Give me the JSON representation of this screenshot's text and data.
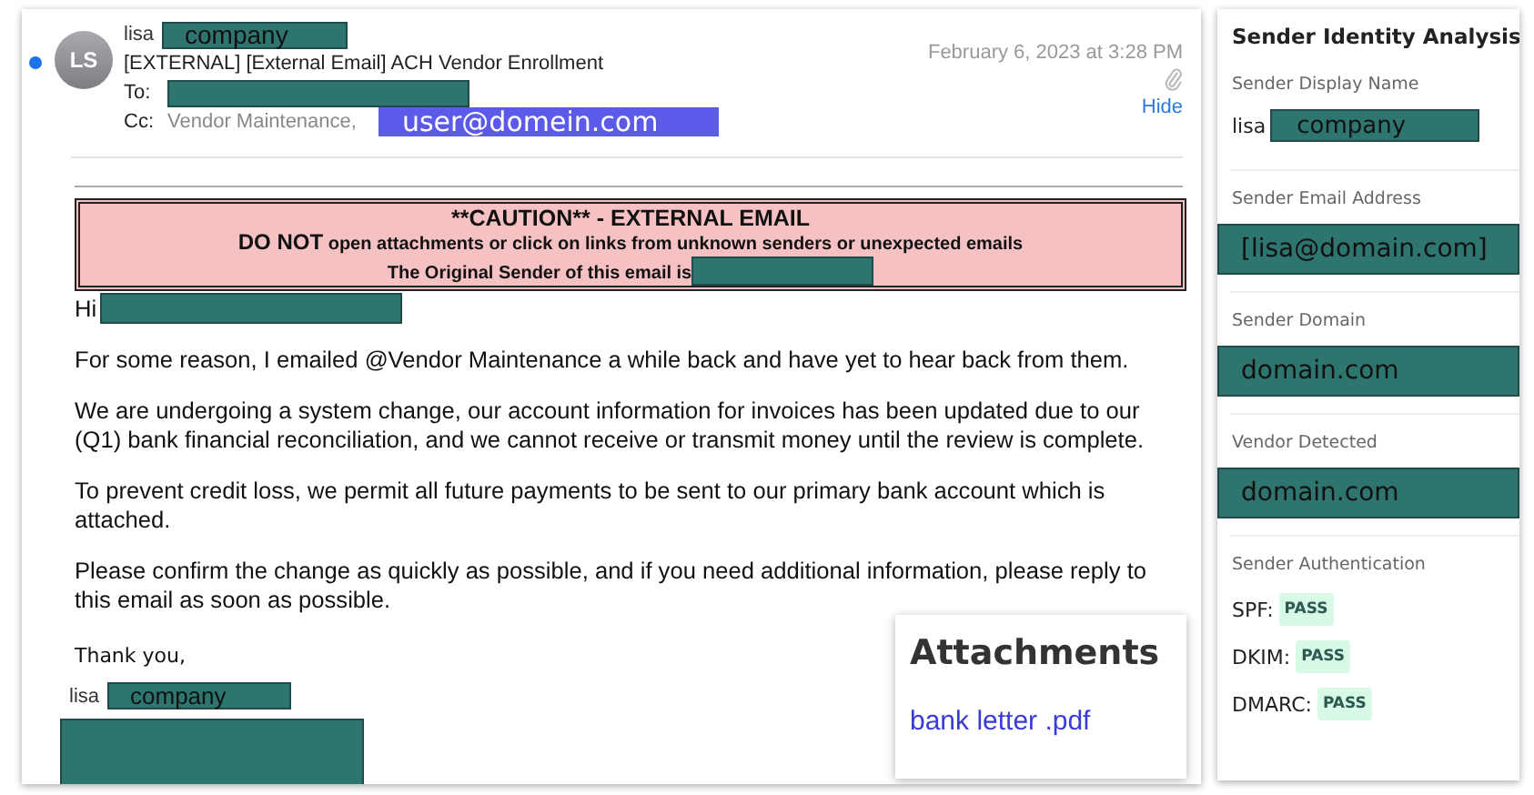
{
  "email": {
    "unread": true,
    "avatar": "LS",
    "sender": {
      "name": "lisa",
      "redaction": "company"
    },
    "date": "February 6, 2023 at 3:28 PM",
    "subject": "[EXTERNAL] [External Email] ACH Vendor Enrollment",
    "to": {
      "label": "To:"
    },
    "cc": {
      "label": "Cc:",
      "value": "Vendor Maintenance,",
      "highlight": "user@domein.com"
    },
    "hide_link": "Hide",
    "caution": {
      "title": "**CAUTION** - EXTERNAL EMAIL",
      "emphasis": "DO NOT",
      "warning": "open attachments or click on links from unknown senders or unexpected emails",
      "sender_line": "The Original Sender of this email is"
    },
    "greeting": "Hi",
    "paragraphs": [
      "For some reason, I emailed @Vendor Maintenance a while back and have yet to hear back from them.",
      "We are undergoing a system change, our account information for invoices has been updated due to our (Q1) bank financial reconciliation, and we cannot receive or transmit money until the review is complete.",
      "To prevent credit loss, we permit all future payments to be sent to our primary bank account which is attached.",
      "Please confirm the change as quickly as possible, and if you need additional information, please reply to this email as soon as possible."
    ],
    "closing": "Thank you,",
    "signature": {
      "name": "lisa",
      "redaction": "company"
    }
  },
  "attachments": {
    "title": "Attachments",
    "files": [
      "bank letter .pdf"
    ]
  },
  "analysis": {
    "title": "Sender Identity Analysis",
    "sections": [
      {
        "label": "Sender Display Name",
        "kind": "name",
        "prefix": "lisa",
        "value": "company"
      },
      {
        "label": "Sender Email Address",
        "kind": "block",
        "value": "[lisa@domain.com]"
      },
      {
        "label": "Sender Domain",
        "kind": "block",
        "value": "domain.com"
      },
      {
        "label": "Vendor Detected",
        "kind": "block",
        "value": "domain.com"
      },
      {
        "label": "Sender Authentication",
        "kind": "auth",
        "checks": [
          {
            "name": "SPF:",
            "result": "PASS"
          },
          {
            "name": "DKIM:",
            "result": "PASS"
          },
          {
            "name": "DMARC:",
            "result": "PASS"
          }
        ]
      }
    ]
  }
}
